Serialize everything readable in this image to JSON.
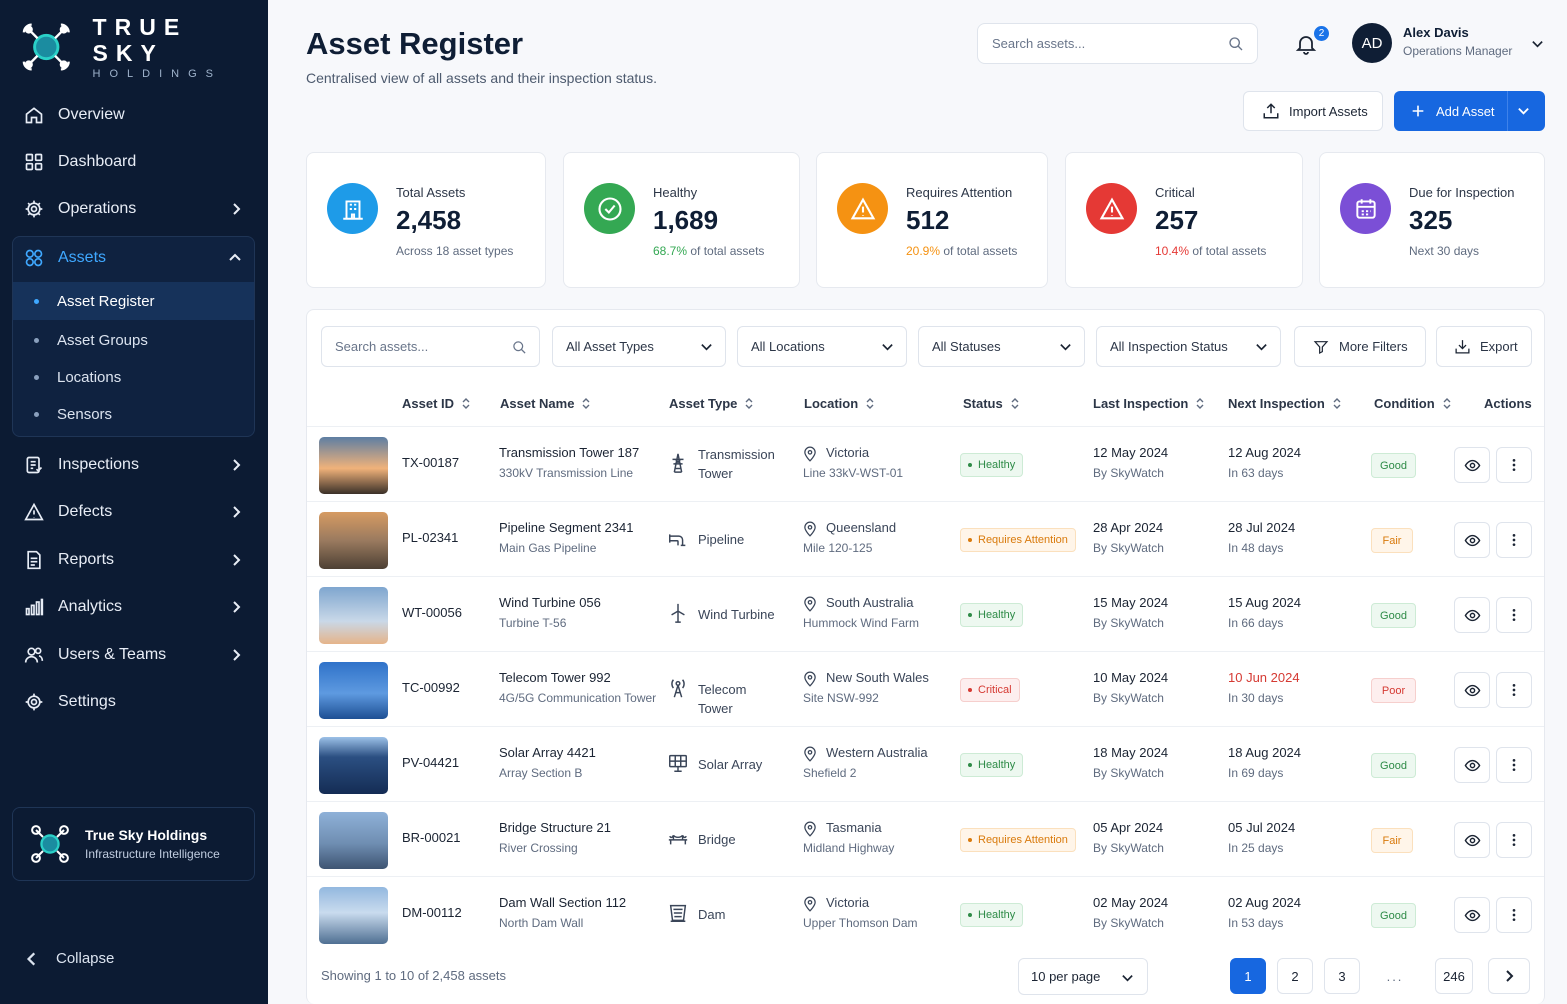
{
  "brand": {
    "name_line1": "TRUE SKY",
    "name_line2": "HOLDINGS"
  },
  "sidebar": {
    "items": [
      {
        "label": "Overview",
        "icon": "home-icon"
      },
      {
        "label": "Dashboard",
        "icon": "grid-icon"
      },
      {
        "label": "Operations",
        "icon": "gear-icon"
      },
      {
        "label": "Assets",
        "icon": "assets-icon"
      },
      {
        "label": "Inspections",
        "icon": "clipboard-icon"
      },
      {
        "label": "Defects",
        "icon": "warning-icon"
      },
      {
        "label": "Reports",
        "icon": "report-icon"
      },
      {
        "label": "Analytics",
        "icon": "bar-chart-icon"
      },
      {
        "label": "Users & Teams",
        "icon": "users-icon"
      },
      {
        "label": "Settings",
        "icon": "gear-icon"
      }
    ],
    "asset_subitems": [
      "Asset Register",
      "Asset Groups",
      "Locations",
      "Sensors"
    ],
    "company": {
      "name": "True Sky Holdings",
      "tagline": "Infrastructure Intelligence"
    },
    "collapse_label": "Collapse"
  },
  "header": {
    "title": "Asset Register",
    "subtitle": "Centralised view of all assets and their inspection status.",
    "search_placeholder": "Search assets...",
    "notification_count": "2",
    "user": {
      "initials": "AD",
      "name": "Alex Davis",
      "role": "Operations Manager"
    },
    "import_label": "Import Assets",
    "add_label": "Add Asset"
  },
  "stats": [
    {
      "label": "Total Assets",
      "value": "2,458",
      "sub_prefix": "",
      "sub_text": "Across 18 asset types",
      "color": "#1e9be8",
      "icon": "building-icon"
    },
    {
      "label": "Healthy",
      "value": "1,689",
      "sub_prefix": "68.7%",
      "sub_text": " of total assets",
      "color": "#34a853",
      "icon": "check-circle-icon"
    },
    {
      "label": "Requires Attention",
      "value": "512",
      "sub_prefix": "20.9%",
      "sub_text": " of total assets",
      "color": "#f59212",
      "icon": "warning-icon"
    },
    {
      "label": "Critical",
      "value": "257",
      "sub_prefix": "10.4%",
      "sub_text": " of total assets",
      "color": "#e53935",
      "icon": "alert-icon"
    },
    {
      "label": "Due for Inspection",
      "value": "325",
      "sub_prefix": "",
      "sub_text": "Next 30 days",
      "color": "#7b4fd6",
      "icon": "calendar-icon"
    }
  ],
  "filters": {
    "search_placeholder": "Search assets...",
    "asset_types": "All Asset Types",
    "locations": "All Locations",
    "statuses": "All Statuses",
    "inspection_status": "All Inspection Status",
    "more_filters": "More Filters",
    "export": "Export"
  },
  "table": {
    "columns": [
      "Asset ID",
      "Asset Name",
      "Asset Type",
      "Location",
      "Status",
      "Last Inspection",
      "Next Inspection",
      "Condition",
      "Actions"
    ],
    "rows": [
      {
        "id": "TX-00187",
        "name": "Transmission Tower 187",
        "desc": "330kV Transmission Line",
        "type": "Transmission Tower",
        "type_icon": "tower-icon",
        "region": "Victoria",
        "site": "Line 33kV-WST-01",
        "status": "Healthy",
        "last_date": "12 May 2024",
        "last_by": "By SkyWatch",
        "next_date": "12 Aug 2024",
        "next_in": "In 63 days",
        "condition": "Good"
      },
      {
        "id": "PL-02341",
        "name": "Pipeline Segment 2341",
        "desc": "Main Gas Pipeline",
        "type": "Pipeline",
        "type_icon": "pipeline-icon",
        "region": "Queensland",
        "site": "Mile 120-125",
        "status": "Requires Attention",
        "last_date": "28 Apr 2024",
        "last_by": "By SkyWatch",
        "next_date": "28 Jul 2024",
        "next_in": "In 48 days",
        "condition": "Fair"
      },
      {
        "id": "WT-00056",
        "name": "Wind Turbine 056",
        "desc": "Turbine T-56",
        "type": "Wind Turbine",
        "type_icon": "wind-turbine-icon",
        "region": "South Australia",
        "site": "Hummock Wind Farm",
        "status": "Healthy",
        "last_date": "15 May 2024",
        "last_by": "By SkyWatch",
        "next_date": "15 Aug 2024",
        "next_in": "In 66 days",
        "condition": "Good"
      },
      {
        "id": "TC-00992",
        "name": "Telecom Tower 992",
        "desc": "4G/5G Communication Tower",
        "type": "Telecom Tower",
        "type_icon": "antenna-icon",
        "region": "New South Wales",
        "site": "Site NSW-992",
        "status": "Critical",
        "last_date": "10 May 2024",
        "last_by": "By SkyWatch",
        "next_date": "10 Jun 2024",
        "next_in": "In 30 days",
        "condition": "Poor"
      },
      {
        "id": "PV-04421",
        "name": "Solar Array 4421",
        "desc": "Array Section B",
        "type": "Solar Array",
        "type_icon": "solar-panel-icon",
        "region": "Western Australia",
        "site": "Shefield 2",
        "status": "Healthy",
        "last_date": "18 May 2024",
        "last_by": "By SkyWatch",
        "next_date": "18 Aug 2024",
        "next_in": "In 69 days",
        "condition": "Good"
      },
      {
        "id": "BR-00021",
        "name": "Bridge Structure 21",
        "desc": "River Crossing",
        "type": "Bridge",
        "type_icon": "bridge-icon",
        "region": "Tasmania",
        "site": "Midland Highway",
        "status": "Requires Attention",
        "last_date": "05 Apr 2024",
        "last_by": "By SkyWatch",
        "next_date": "05 Jul 2024",
        "next_in": "In 25 days",
        "condition": "Fair"
      },
      {
        "id": "DM-00112",
        "name": "Dam Wall Section 112",
        "desc": "North Dam Wall",
        "type": "Dam",
        "type_icon": "dam-icon",
        "region": "Victoria",
        "site": "Upper Thomson Dam",
        "status": "Healthy",
        "last_date": "02 May 2024",
        "last_by": "By SkyWatch",
        "next_date": "02 Aug 2024",
        "next_in": "In 53 days",
        "condition": "Good"
      }
    ]
  },
  "footer": {
    "showing": "Showing 1 to 10 of 2,458 assets",
    "per_page": "10 per page",
    "pages": [
      "1",
      "2",
      "3",
      "...",
      "246"
    ]
  },
  "colors": {
    "sidebar_bg": "#0c1b33",
    "accent": "#1767e0",
    "healthy": "#34a853",
    "attention": "#f59212",
    "critical": "#e53935"
  }
}
